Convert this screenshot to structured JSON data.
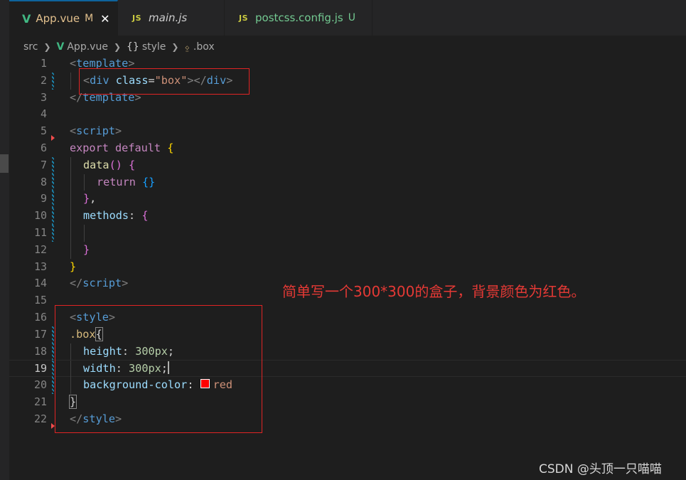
{
  "tabs": [
    {
      "name": "App.vue",
      "icon": "vue-icon",
      "flag": "M",
      "flag_color": "#e2c08d",
      "name_color": "#e2c08d",
      "active": true,
      "close": "✕"
    },
    {
      "name": "main.js",
      "icon": "js-icon",
      "icon_text": "JS",
      "flag": "",
      "name_color": "#cccccc",
      "active": false
    },
    {
      "name": "postcss.config.js",
      "icon": "js-icon",
      "icon_text": "JS",
      "flag": "U",
      "flag_color": "#73c991",
      "name_color": "#73c991",
      "active": false
    }
  ],
  "breadcrumb": {
    "folder": "src",
    "file": "App.vue",
    "section": "style",
    "selector": ".box",
    "brace_glyph": "{}",
    "selector_glyph": "⍚"
  },
  "line_numbers": [
    "1",
    "2",
    "3",
    "4",
    "5",
    "6",
    "7",
    "8",
    "9",
    "10",
    "11",
    "12",
    "13",
    "14",
    "15",
    "16",
    "17",
    "18",
    "19",
    "20",
    "21",
    "22"
  ],
  "current_line": "19",
  "code": {
    "l1": {
      "open": "<",
      "tag": "template",
      "close": ">"
    },
    "l2": {
      "open": "<",
      "tag": "div",
      "attr": "class",
      "eq": "=",
      "value": "\"box\"",
      "mid": "></",
      "tag2": "div",
      "close": ">"
    },
    "l3": {
      "open": "</",
      "tag": "template",
      "close": ">"
    },
    "l5": {
      "open": "<",
      "tag": "script",
      "close": ">"
    },
    "l6": {
      "kw1": "export",
      "kw2": "default",
      "brace": "{"
    },
    "l7": {
      "fn": "data",
      "parens": "()",
      "brace": "{"
    },
    "l8": {
      "kw": "return",
      "braces": "{}"
    },
    "l9": {
      "brace": "}",
      "comma": ","
    },
    "l10": {
      "prop": "methods",
      "colon": ":",
      "brace": "{"
    },
    "l12": {
      "brace": "}"
    },
    "l13": {
      "brace": "}"
    },
    "l14": {
      "open": "</",
      "tag": "script",
      "close": ">"
    },
    "l16": {
      "open": "<",
      "tag": "style",
      "close": ">"
    },
    "l17": {
      "selector": ".box",
      "brace": "{"
    },
    "l18": {
      "prop": "height",
      "colon": ":",
      "value": "300px",
      "semi": ";"
    },
    "l19": {
      "prop": "width",
      "colon": ":",
      "value": "300px",
      "semi": ";"
    },
    "l20": {
      "prop": "background-color",
      "colon": ":",
      "value": "red",
      "swatch_color": "#ff0000"
    },
    "l21": {
      "brace": "}"
    },
    "l22": {
      "open": "</",
      "tag": "style",
      "close": ">"
    }
  },
  "annotation": {
    "note": "简单写一个300*300的盒子，背景颜色为红色。",
    "color": "#e53935"
  },
  "watermark": "CSDN @头顶一只喵喵"
}
